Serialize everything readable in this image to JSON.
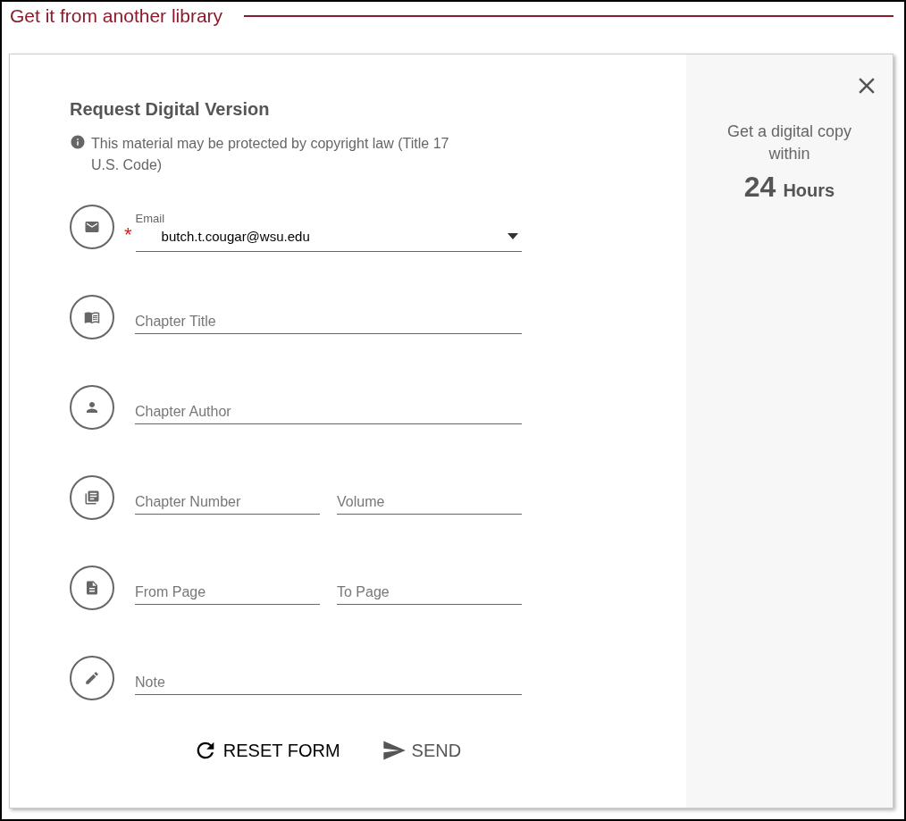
{
  "section": {
    "title": "Get it from another library"
  },
  "form": {
    "title": "Request Digital Version",
    "notice": "This material may be protected by copyright law (Title 17 U.S. Code)",
    "rows": [
      {
        "kind": "select",
        "label": "Email",
        "value": "butch.t.cougar@wsu.edu",
        "required_mark": "*"
      },
      {
        "kind": "text",
        "fields": [
          {
            "placeholder": "Chapter Title"
          }
        ]
      },
      {
        "kind": "text",
        "fields": [
          {
            "placeholder": "Chapter Author"
          }
        ]
      },
      {
        "kind": "text",
        "fields": [
          {
            "placeholder": "Chapter Number"
          },
          {
            "placeholder": "Volume"
          }
        ]
      },
      {
        "kind": "text",
        "fields": [
          {
            "placeholder": "From Page"
          },
          {
            "placeholder": "To Page"
          }
        ]
      },
      {
        "kind": "text",
        "fields": [
          {
            "placeholder": "Note"
          }
        ]
      }
    ],
    "buttons": [
      {
        "kind": "reset",
        "label": "RESET FORM"
      },
      {
        "kind": "send",
        "label": "SEND"
      }
    ]
  },
  "sidebar": {
    "text": "Get a digital copy within",
    "number": "24",
    "unit": "Hours"
  }
}
